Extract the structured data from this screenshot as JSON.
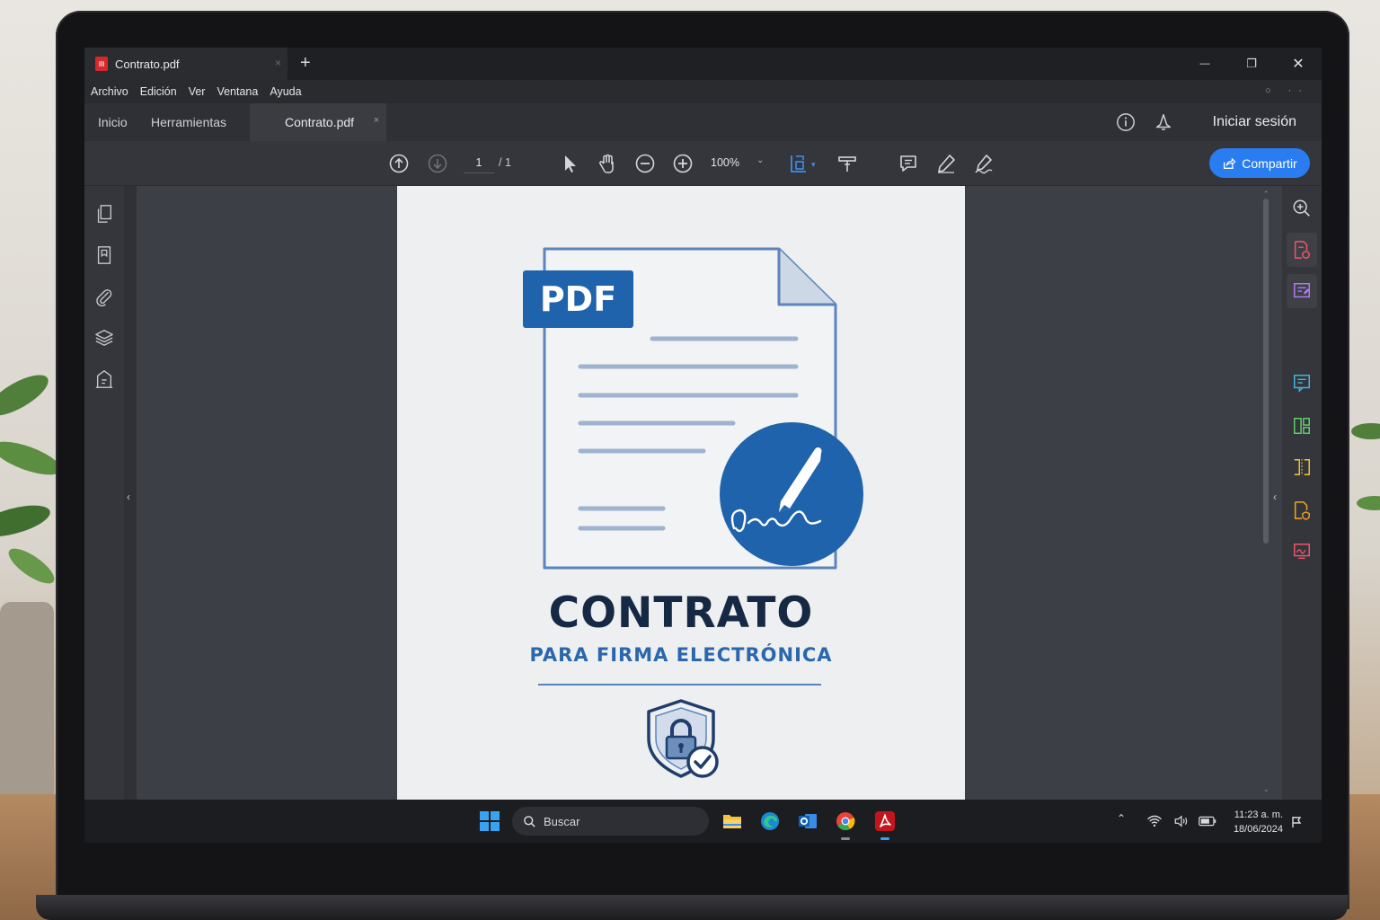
{
  "window": {
    "tab_title": "Contrato.pdf",
    "new_tab_symbol": "+",
    "tab_close_symbol": "×",
    "minimize_symbol": "—",
    "maximize_symbol": "❐",
    "close_symbol": "✕"
  },
  "menu": {
    "items": [
      "Archivo",
      "Edición",
      "Ver",
      "Ventana",
      "Ayuda"
    ]
  },
  "app_tabs": {
    "home": "Inicio",
    "tools": "Herramientas",
    "document": "Contrato.pdf",
    "close_symbol": "×",
    "sign_in": "Iniciar sesión"
  },
  "toolbar": {
    "page_current": "1",
    "page_total": "/ 1",
    "zoom": "100%",
    "zoom_caret": "⌄",
    "share_label": "Compartir"
  },
  "document": {
    "badge": "PDF",
    "title": "CONTRATO",
    "subtitle": "PARA FIRMA ELECTRÓNICA"
  },
  "taskbar": {
    "search_placeholder": "Buscar",
    "time": "11:23 a. m.",
    "date": "18/06/2024"
  },
  "colors": {
    "accent": "#2a7df0",
    "doc_blue": "#1f63ad",
    "doc_navy": "#152844",
    "pdf_red": "#d5292c"
  },
  "icons": {
    "left_rail": [
      "pages-icon",
      "bookmark-icon",
      "attachment-icon",
      "layers-icon",
      "tags-icon"
    ],
    "right_rail": [
      "zoom-in-icon",
      "export-pdf-icon",
      "edit-pdf-icon",
      "comment-icon",
      "organize-pages-icon",
      "compare-icon",
      "protect-icon",
      "fill-sign-icon"
    ]
  }
}
